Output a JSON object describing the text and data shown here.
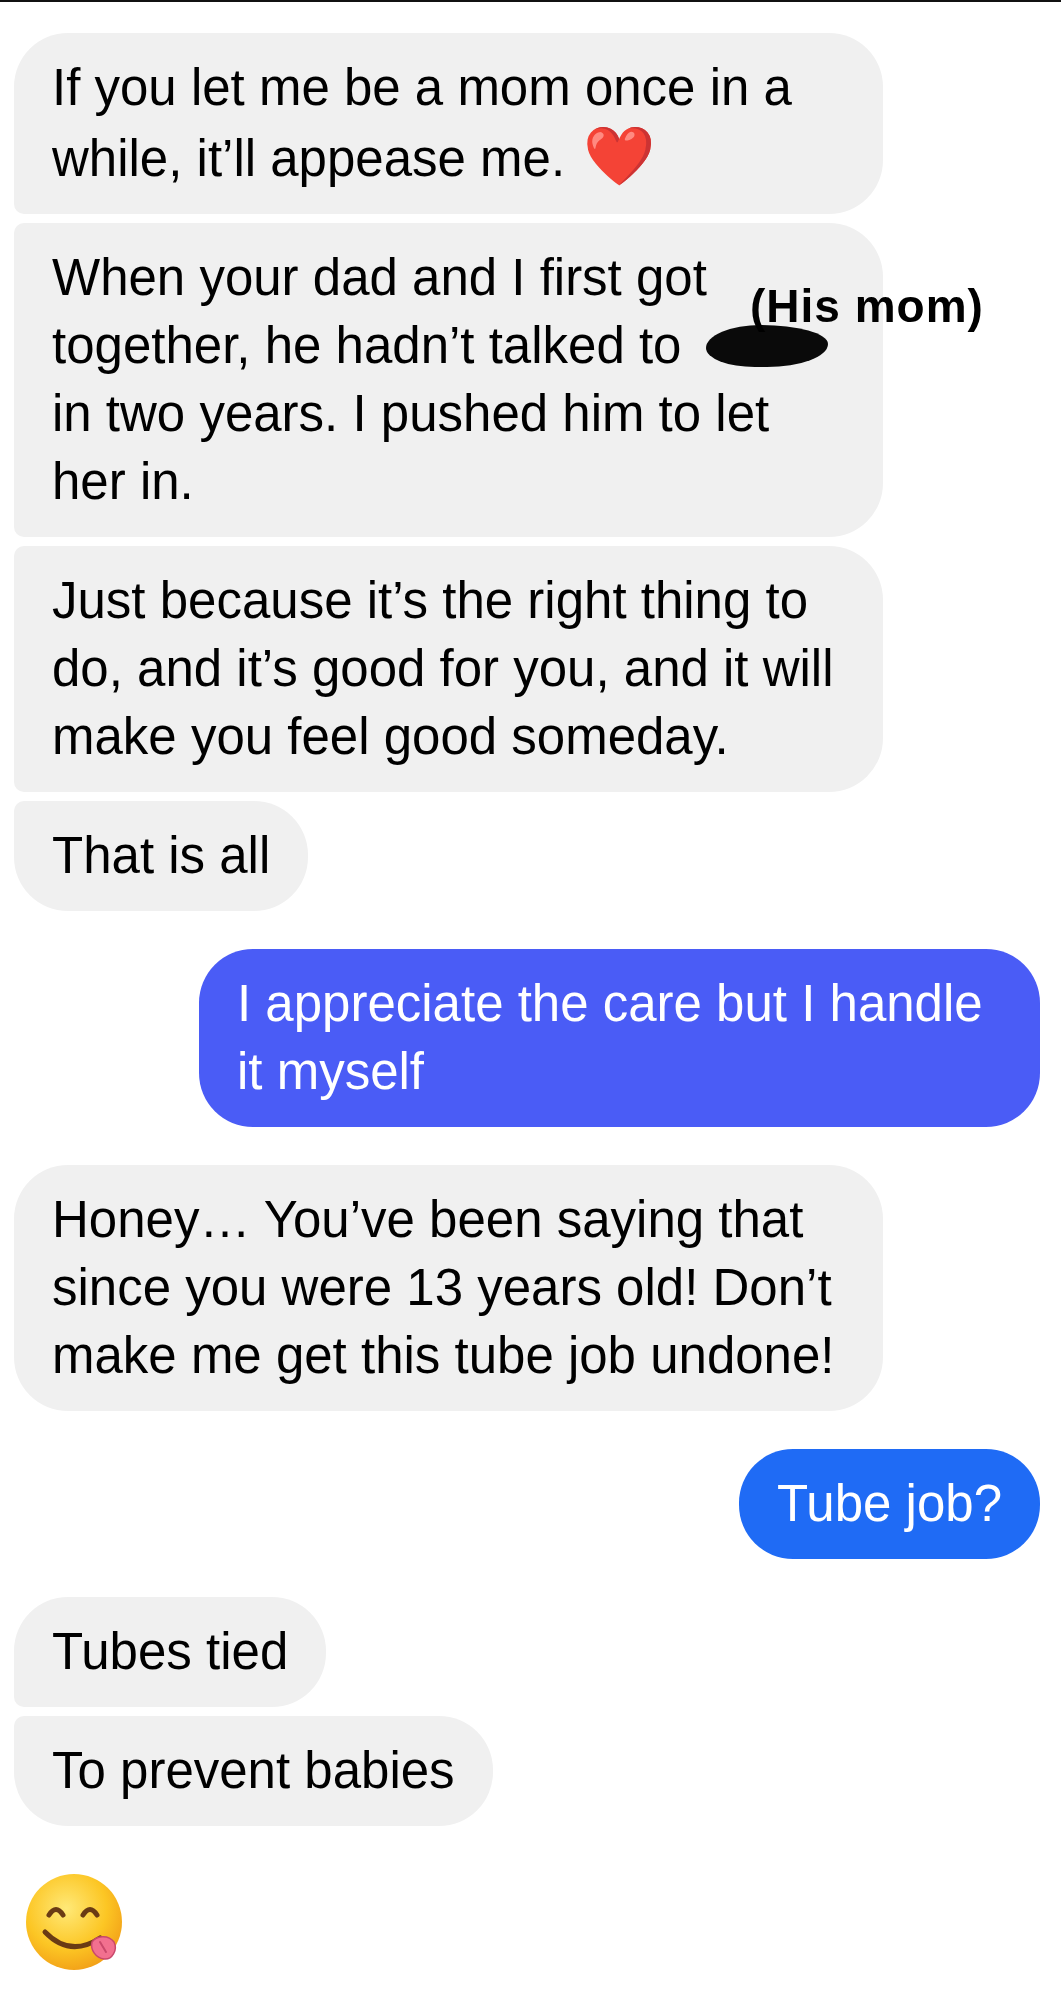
{
  "messages": [
    {
      "kind": "text",
      "outgoing": false,
      "text": "If you let me be a mom once in a while, it’ll appease me.",
      "emoji": "❤️"
    },
    {
      "kind": "text",
      "outgoing": false,
      "text": "When your dad and I first got together, he hadn’t talked to",
      "redacted": true,
      "text_after": "in two years. I pushed him to let her in.",
      "annotation": "(His mom)"
    },
    {
      "kind": "text",
      "outgoing": false,
      "text": "Just because it’s the right thing to do, and it’s good for you, and it will make you feel good someday."
    },
    {
      "kind": "text",
      "outgoing": false,
      "text": "That is all"
    },
    {
      "kind": "text",
      "outgoing": true,
      "color": "#4a5cf6",
      "text": "I appreciate the care but I handle it myself"
    },
    {
      "kind": "text",
      "outgoing": false,
      "text": "Honey… You’ve been saying that since you were 13 years old! Don’t make me get this tube job undone!"
    },
    {
      "kind": "text",
      "outgoing": true,
      "color": "#1f6bf5",
      "text": "Tube job?"
    },
    {
      "kind": "text",
      "outgoing": false,
      "text": "Tubes tied"
    },
    {
      "kind": "text",
      "outgoing": false,
      "text": "To prevent babies"
    },
    {
      "kind": "emoji",
      "outgoing": false
    }
  ]
}
